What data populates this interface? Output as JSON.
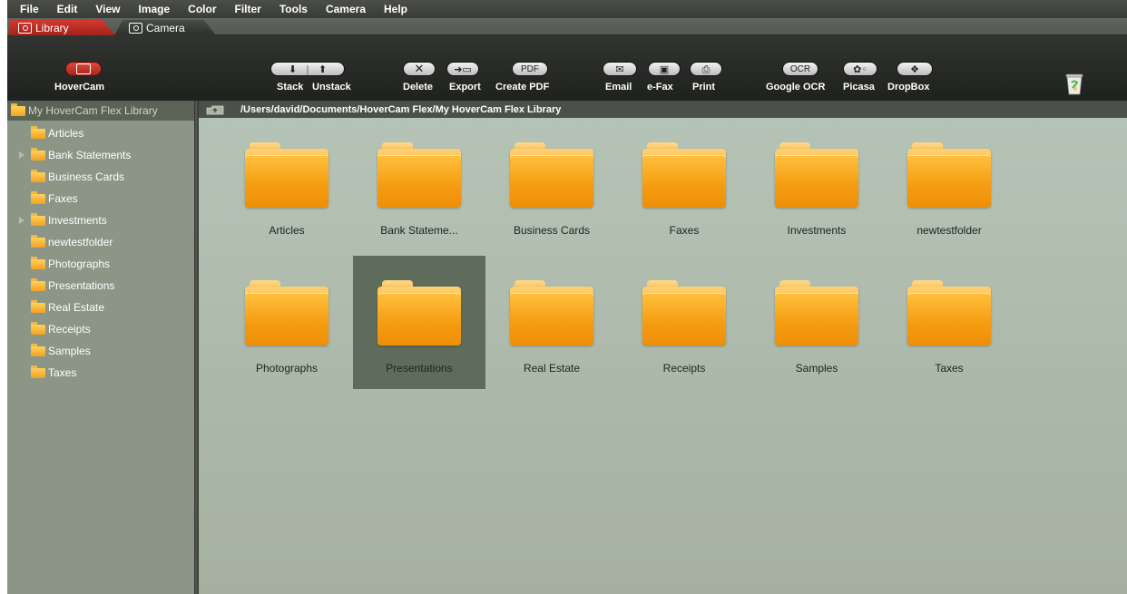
{
  "menu": [
    "File",
    "Edit",
    "View",
    "Image",
    "Color",
    "Filter",
    "Tools",
    "Camera",
    "Help"
  ],
  "tabs": [
    {
      "label": "Library",
      "active": true
    },
    {
      "label": "Camera",
      "active": false
    }
  ],
  "toolbar": {
    "hovercam": "HoverCam",
    "stack": "Stack",
    "unstack": "Unstack",
    "delete": "Delete",
    "export": "Export",
    "create_pdf": "Create PDF",
    "pdf_glyph": "PDF",
    "email": "Email",
    "efax": "e-Fax",
    "print": "Print",
    "google_ocr": "Google OCR",
    "ocr_glyph": "OCR",
    "picasa": "Picasa",
    "dropbox": "DropBox"
  },
  "sidebar": {
    "root": "My HoverCam Flex Library",
    "items": [
      {
        "label": "Articles",
        "expandable": false
      },
      {
        "label": "Bank Statements",
        "expandable": true
      },
      {
        "label": "Business Cards",
        "expandable": false
      },
      {
        "label": "Faxes",
        "expandable": false
      },
      {
        "label": "Investments",
        "expandable": true
      },
      {
        "label": "newtestfolder",
        "expandable": false
      },
      {
        "label": "Photographs",
        "expandable": false
      },
      {
        "label": "Presentations",
        "expandable": false
      },
      {
        "label": "Real Estate",
        "expandable": false
      },
      {
        "label": "Receipts",
        "expandable": false
      },
      {
        "label": "Samples",
        "expandable": false
      },
      {
        "label": "Taxes",
        "expandable": false
      }
    ]
  },
  "path": "/Users/david/Documents/HoverCam Flex/My HoverCam Flex Library",
  "folders": [
    {
      "label": "Articles"
    },
    {
      "label": "Bank Stateme..."
    },
    {
      "label": "Business Cards"
    },
    {
      "label": "Faxes"
    },
    {
      "label": "Investments"
    },
    {
      "label": "newtestfolder"
    },
    {
      "label": "Photographs"
    },
    {
      "label": "Presentations",
      "selected": true
    },
    {
      "label": "Real Estate"
    },
    {
      "label": "Receipts"
    },
    {
      "label": "Samples"
    },
    {
      "label": "Taxes"
    }
  ],
  "colors": {
    "accent": "#c8302a",
    "content_bg": "#aebcad",
    "selection": "#5f6c5c",
    "folder": "#f5a623"
  }
}
